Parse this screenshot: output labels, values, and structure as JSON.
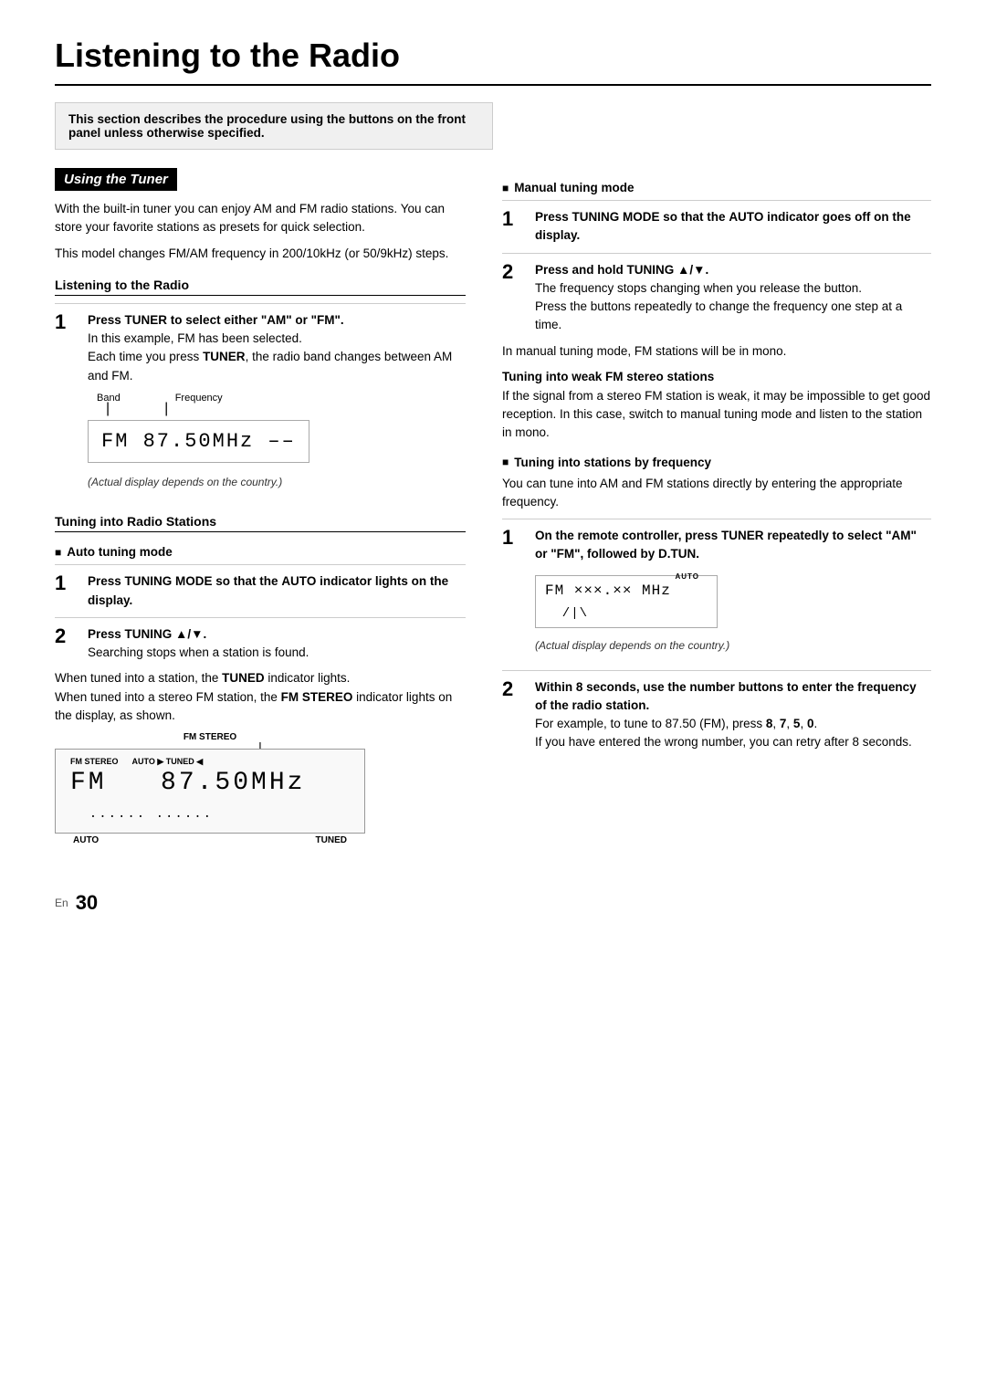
{
  "page": {
    "title": "Listening to the Radio",
    "lang": "En",
    "page_number": "30"
  },
  "intro_box": {
    "text": "This section describes the procedure using the buttons on the front panel unless otherwise specified."
  },
  "left_col": {
    "using_tuner": {
      "heading": "Using the Tuner",
      "para1": "With the built-in tuner you can enjoy AM and FM radio stations. You can store your favorite stations as presets for quick selection.",
      "para2": "This model changes FM/AM frequency in 200/10kHz (or 50/9kHz) steps."
    },
    "listening_radio": {
      "heading": "Listening to the Radio",
      "step1_title": "Press TUNER to select either “AM” or “FM”.",
      "step1_body": "In this example, FM has been selected.",
      "step1_body2_pre": "Each time you press ",
      "step1_body2_bold": "TUNER",
      "step1_body2_post": ", the radio band changes between AM and FM.",
      "display_band": "Band",
      "display_freq": "Frequency",
      "display_text": "FM  87.50MHz ––",
      "display_caption": "(Actual display depends on the country.)"
    },
    "tuning_stations": {
      "heading": "Tuning into Radio Stations",
      "auto_mode": {
        "label": "Auto tuning mode",
        "step1_title": "Press TUNING MODE so that the AUTO indicator lights on the display.",
        "step2_title": "Press TUNING ▲/▼.",
        "step2_body": "Searching stops when a station is found."
      },
      "note1_pre": "When tuned into a station, the ",
      "note1_bold": "TUNED",
      "note1_post": " indicator lights.",
      "note2_pre": "When tuned into a stereo FM station, the ",
      "note2_bold": "FM STEREO",
      "note2_post": " indicator lights on the display, as shown.",
      "display_fm_stereo_label": "FM STEREO",
      "display_inline_labels": "FM STEREO\nAUTO ► TUNED ◄",
      "display_large_text": "FM    87.50MHz",
      "display_dots": "......  ......",
      "display_auto_label": "AUTO",
      "display_tuned_label": "TUNED",
      "display_caption2": ""
    }
  },
  "right_col": {
    "manual_mode": {
      "label": "Manual tuning mode",
      "step1_title": "Press TUNING MODE so that the AUTO indicator goes off on the display.",
      "step2_title": "Press and hold TUNING ▲/▼.",
      "step2_body1": "The frequency stops changing when you release the button.",
      "step2_body2": "Press the buttons repeatedly to change the frequency one step at a time.",
      "note": "In manual tuning mode, FM stations will be in mono."
    },
    "weak_fm": {
      "heading": "Tuning into weak FM stereo stations",
      "body": "If the signal from a stereo FM station is weak, it may be impossible to get good reception. In this case, switch to manual tuning mode and listen to the station in mono."
    },
    "by_frequency": {
      "heading": "Tuning into stations by frequency",
      "intro": "You can tune into AM and FM stations directly by entering the appropriate frequency.",
      "step1_title": "On the remote controller, press TUNER repeatedly to select “AM” or “FM”, followed by D.TUN.",
      "display_text": "FM ×××.×× MHz",
      "display_auto": "AUTO",
      "display_caption": "(Actual display depends on the country.)",
      "step2_title": "Within 8 seconds, use the number buttons to enter the frequency of the radio station.",
      "step2_body1": "For example, to tune to 87.50 (FM), press 8, 7, 5, 0.",
      "step2_body2": "If you have entered the wrong number, you can retry after 8 seconds."
    }
  }
}
